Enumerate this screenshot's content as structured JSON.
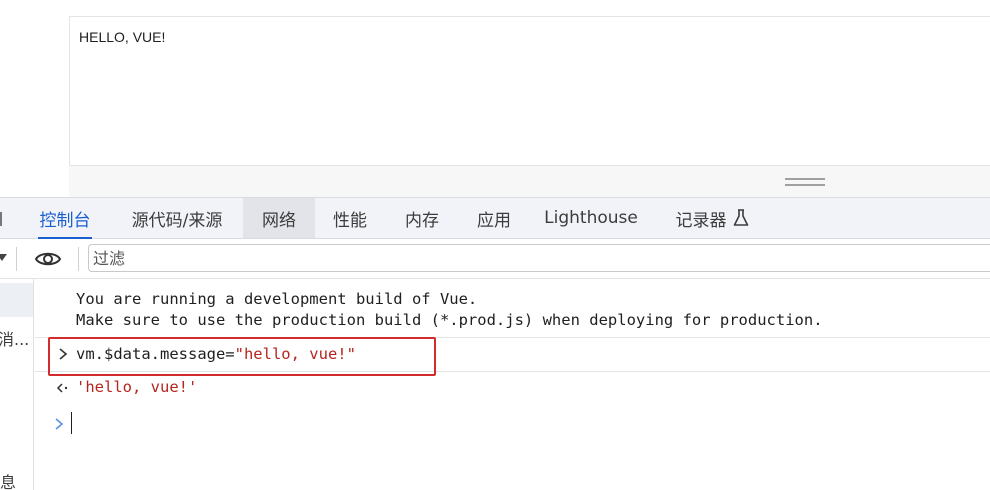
{
  "viewport": {
    "text": "HELLO, VUE!"
  },
  "tabs": [
    {
      "label": "控制台",
      "state": "active"
    },
    {
      "label": "源代码/来源",
      "state": "normal"
    },
    {
      "label": "网络",
      "state": "hover"
    },
    {
      "label": "性能",
      "state": "normal"
    },
    {
      "label": "内存",
      "state": "normal"
    },
    {
      "label": "应用",
      "state": "normal"
    },
    {
      "label": "Lighthouse",
      "state": "normal"
    },
    {
      "label": "记录器",
      "state": "normal",
      "icon": "flask-icon"
    }
  ],
  "toolbar": {
    "filter_placeholder": "过滤",
    "eye_icon": "eye-icon",
    "dropdown_icon": "caret-down-icon"
  },
  "sidebar": {
    "items": [
      {
        "label": "消..."
      },
      {
        "label": "息"
      }
    ]
  },
  "console": {
    "messages": [
      "You are running a development build of Vue.",
      "Make sure to use the production build (*.prod.js) when deploying for production."
    ],
    "input": {
      "code": "vm.$data.message=",
      "string": "\"hello, vue!\""
    },
    "result": "'hello, vue!'"
  },
  "colors": {
    "accent": "#1a5fd0",
    "string": "#b3261e",
    "highlight_border": "#d32b2b"
  }
}
